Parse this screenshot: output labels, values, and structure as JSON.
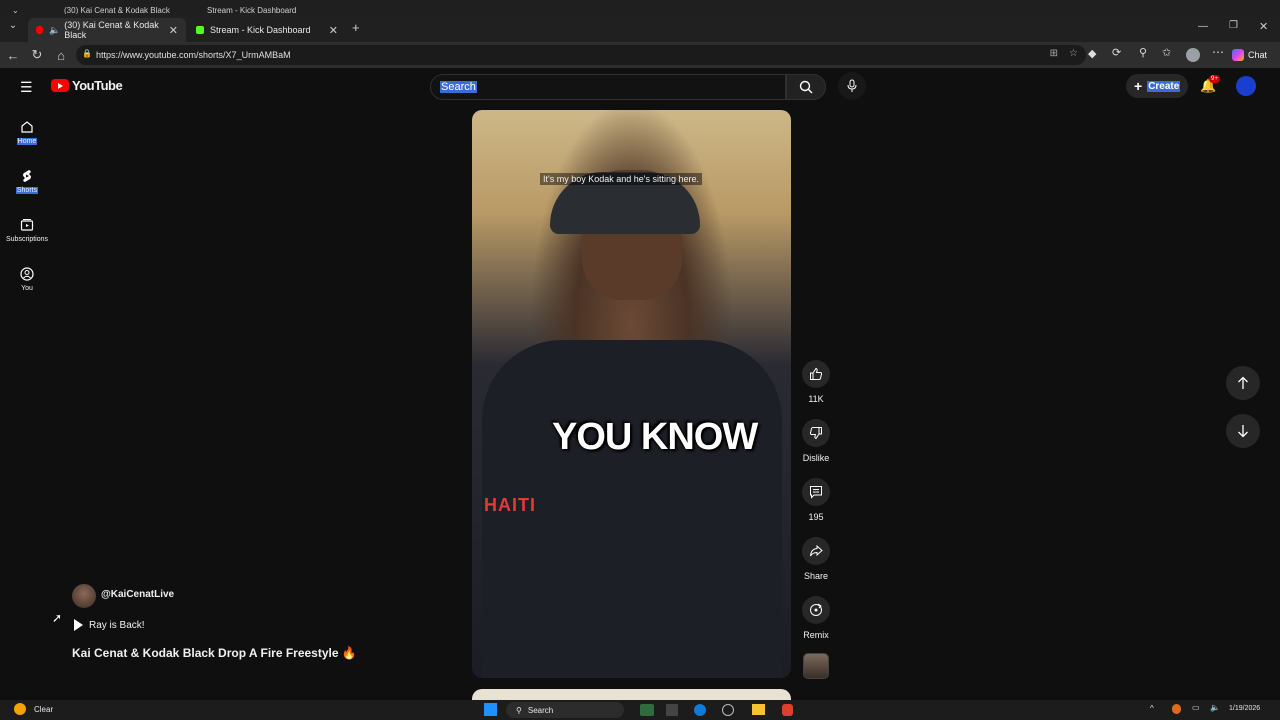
{
  "browser": {
    "ghost_tabs": [
      {
        "label": "(30) Kai Cenat & Kodak Black"
      },
      {
        "label": "Stream - Kick Dashboard"
      }
    ],
    "tabs": [
      {
        "label": "(30) Kai Cenat & Kodak Black"
      },
      {
        "label": "Stream - Kick Dashboard"
      }
    ],
    "url": "https://www.youtube.com/shorts/X7_UrmAMBaM",
    "chat_label": "Chat"
  },
  "youtube": {
    "logo_text": "YouTube",
    "search": {
      "value": "Search"
    },
    "create_label": "Create",
    "notification_badge": "9+",
    "sidebar": [
      {
        "label": "Home",
        "icon": "home-icon"
      },
      {
        "label": "Shorts",
        "icon": "shorts-icon"
      },
      {
        "label": "Subscriptions",
        "icon": "subscriptions-icon"
      },
      {
        "label": "You",
        "icon": "you-icon"
      }
    ],
    "video": {
      "subtitle": "It's my boy Kodak and he's sitting here.",
      "caption": "YOU KNOW",
      "shirt_text": "HAITI"
    },
    "actions": {
      "like_count": "11K",
      "dislike_label": "Dislike",
      "comments_count": "195",
      "share_label": "Share",
      "remix_label": "Remix"
    },
    "channel": "@KaiCenatLive",
    "sound": "Ray is Back!",
    "title": "Kai Cenat & Kodak Black Drop A Fire Freestyle 🔥"
  },
  "taskbar": {
    "weather": "Clear",
    "search": "Search",
    "date": "1/19/2026"
  }
}
